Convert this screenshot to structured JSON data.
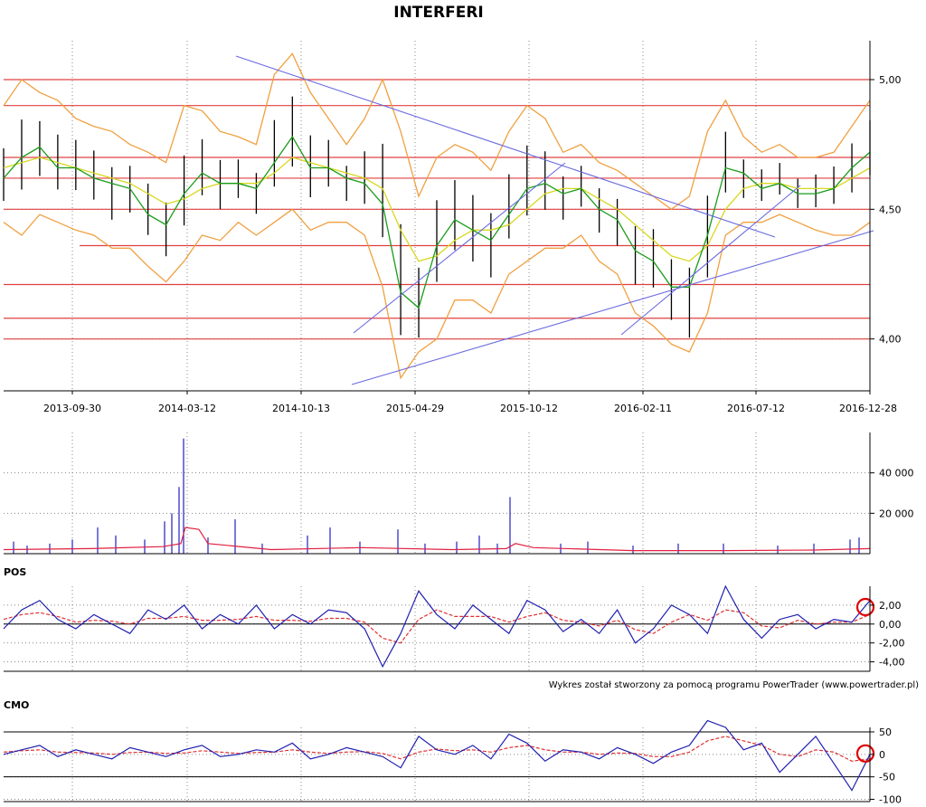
{
  "title": "INTERFERI",
  "credit": "Wykres został stworzony za pomocą programu PowerTrader (www.powertrader.pl)",
  "colors": {
    "bars": "#000000",
    "ma_fast": "#1a9c1a",
    "ma_slow": "#d8d820",
    "bands": "#f0a040",
    "levels": "#e04040",
    "trendlines": "#6a6ae0",
    "volume_bars": "#2020c0",
    "volume_ma": "#e02040",
    "indicator_line": "#2020b0",
    "indicator_signal": "#e03030",
    "highlight_circle": "#e00000"
  },
  "chart_data": [
    {
      "type": "line",
      "name": "price",
      "x_ticks": [
        "2013-09-30",
        "2014-03-12",
        "2014-10-13",
        "2015-04-29",
        "2015-10-12",
        "2016-02-11",
        "2016-07-12",
        "2016-12-28"
      ],
      "y_ticks": [
        "5,00",
        "4,50",
        "4,00"
      ],
      "ylim": [
        3.8,
        5.15
      ],
      "horizontal_levels": [
        5.0,
        4.9,
        4.7,
        4.62,
        4.5,
        4.36,
        4.21,
        4.08,
        4.0
      ],
      "series": [
        {
          "name": "",
          "style": "ohlc-bars",
          "values": [
            4.6,
            4.72,
            4.75,
            4.68,
            4.7,
            4.65,
            4.55,
            4.6,
            4.5,
            4.4,
            4.55,
            4.68,
            4.6,
            4.62,
            4.55,
            4.7,
            4.8,
            4.65,
            4.7,
            4.6,
            4.62,
            4.55,
            4.15,
            4.05,
            4.4,
            4.5,
            4.42,
            4.35,
            4.5,
            4.62,
            4.62,
            4.55,
            4.6,
            4.5,
            4.45,
            4.3,
            4.32,
            4.15,
            4.05,
            4.35,
            4.7,
            4.62,
            4.6,
            4.62,
            4.55,
            4.58,
            4.62,
            4.7,
            4.78
          ]
        },
        {
          "name": "",
          "style": "ma-fast",
          "values": [
            4.62,
            4.7,
            4.74,
            4.66,
            4.66,
            4.62,
            4.6,
            4.58,
            4.48,
            4.44,
            4.56,
            4.64,
            4.6,
            4.6,
            4.58,
            4.68,
            4.78,
            4.66,
            4.66,
            4.62,
            4.6,
            4.52,
            4.18,
            4.12,
            4.36,
            4.46,
            4.42,
            4.38,
            4.48,
            4.58,
            4.6,
            4.56,
            4.58,
            4.5,
            4.46,
            4.34,
            4.3,
            4.2,
            4.2,
            4.4,
            4.66,
            4.64,
            4.58,
            4.6,
            4.56,
            4.56,
            4.58,
            4.66,
            4.72
          ]
        },
        {
          "name": "",
          "style": "ma-slow",
          "values": [
            4.66,
            4.68,
            4.7,
            4.68,
            4.66,
            4.64,
            4.62,
            4.6,
            4.56,
            4.52,
            4.54,
            4.58,
            4.6,
            4.6,
            4.6,
            4.64,
            4.7,
            4.68,
            4.66,
            4.64,
            4.62,
            4.58,
            4.42,
            4.3,
            4.32,
            4.38,
            4.42,
            4.42,
            4.44,
            4.5,
            4.56,
            4.58,
            4.58,
            4.54,
            4.5,
            4.44,
            4.38,
            4.32,
            4.3,
            4.36,
            4.5,
            4.58,
            4.6,
            4.6,
            4.58,
            4.58,
            4.58,
            4.62,
            4.66
          ]
        },
        {
          "name": "",
          "style": "band-upper",
          "values": [
            4.9,
            5.0,
            4.95,
            4.92,
            4.85,
            4.82,
            4.8,
            4.75,
            4.72,
            4.68,
            4.9,
            4.88,
            4.8,
            4.78,
            4.75,
            5.02,
            5.1,
            4.95,
            4.85,
            4.75,
            4.85,
            5.0,
            4.8,
            4.55,
            4.7,
            4.75,
            4.72,
            4.65,
            4.8,
            4.9,
            4.85,
            4.72,
            4.75,
            4.68,
            4.65,
            4.6,
            4.55,
            4.5,
            4.55,
            4.8,
            4.92,
            4.78,
            4.72,
            4.75,
            4.7,
            4.7,
            4.72,
            4.82,
            4.92
          ]
        },
        {
          "name": "",
          "style": "band-lower",
          "values": [
            4.45,
            4.4,
            4.48,
            4.45,
            4.42,
            4.4,
            4.35,
            4.35,
            4.28,
            4.22,
            4.3,
            4.4,
            4.38,
            4.45,
            4.4,
            4.45,
            4.5,
            4.42,
            4.45,
            4.45,
            4.4,
            4.2,
            3.85,
            3.95,
            4.0,
            4.15,
            4.15,
            4.1,
            4.25,
            4.3,
            4.35,
            4.35,
            4.4,
            4.3,
            4.25,
            4.1,
            4.05,
            3.98,
            3.95,
            4.1,
            4.4,
            4.45,
            4.45,
            4.48,
            4.45,
            4.42,
            4.4,
            4.4,
            4.45
          ]
        }
      ]
    },
    {
      "type": "bar",
      "name": "volume",
      "y_ticks": [
        "40 000",
        "20 000"
      ],
      "ylim": [
        0,
        60000
      ]
    },
    {
      "type": "line",
      "label": "POS",
      "y_ticks": [
        "2,00",
        "0,00",
        "-2,00",
        "-4,00"
      ],
      "ylim": [
        -5,
        4
      ],
      "series": [
        {
          "name": "",
          "values": [
            -0.5,
            1.5,
            2.5,
            0.5,
            -0.5,
            1.0,
            0.0,
            -1.0,
            1.5,
            0.5,
            2.0,
            -0.5,
            1.0,
            0.0,
            2.0,
            -0.5,
            1.0,
            0.0,
            1.5,
            1.2,
            -0.5,
            -4.5,
            -1.0,
            3.5,
            1.0,
            -0.5,
            2.0,
            0.5,
            -1.0,
            2.5,
            1.5,
            -0.8,
            0.5,
            -1.0,
            1.5,
            -2.0,
            -0.5,
            2.0,
            1.0,
            -1.0,
            4.0,
            0.5,
            -1.5,
            0.5,
            1.0,
            -0.5,
            0.5,
            0.2,
            2.5
          ]
        },
        {
          "name": "",
          "values": [
            0.5,
            1.0,
            1.2,
            0.8,
            0.2,
            0.4,
            0.3,
            0.0,
            0.6,
            0.6,
            0.8,
            0.4,
            0.4,
            0.5,
            0.8,
            0.4,
            0.4,
            0.3,
            0.6,
            0.6,
            0.2,
            -1.5,
            -2.0,
            0.5,
            1.5,
            0.8,
            0.8,
            0.8,
            0.2,
            0.8,
            1.2,
            0.4,
            0.2,
            -0.2,
            0.4,
            -0.6,
            -1.0,
            0.2,
            1.0,
            0.4,
            1.5,
            1.2,
            -0.2,
            -0.4,
            0.4,
            0.0,
            0.2,
            0.2,
            1.0
          ]
        }
      ]
    },
    {
      "type": "line",
      "label": "CMO",
      "y_ticks": [
        "50",
        "0",
        "-50",
        "-100"
      ],
      "ylim": [
        -105,
        60
      ],
      "series": [
        {
          "name": "",
          "values": [
            0,
            10,
            20,
            -5,
            10,
            0,
            -10,
            15,
            5,
            -5,
            10,
            20,
            -5,
            0,
            10,
            5,
            25,
            -10,
            0,
            15,
            5,
            -5,
            -30,
            40,
            10,
            0,
            20,
            -10,
            45,
            25,
            -15,
            10,
            5,
            -10,
            15,
            0,
            -20,
            5,
            20,
            75,
            60,
            10,
            25,
            -40,
            0,
            40,
            -20,
            -80,
            0
          ]
        },
        {
          "name": "",
          "values": [
            5,
            8,
            10,
            5,
            4,
            3,
            0,
            4,
            5,
            2,
            3,
            8,
            5,
            2,
            4,
            5,
            10,
            5,
            2,
            5,
            6,
            2,
            -10,
            5,
            12,
            8,
            10,
            5,
            15,
            20,
            10,
            5,
            5,
            0,
            3,
            2,
            -5,
            -5,
            5,
            30,
            40,
            30,
            20,
            0,
            -5,
            10,
            5,
            -15,
            -10
          ]
        }
      ]
    }
  ]
}
